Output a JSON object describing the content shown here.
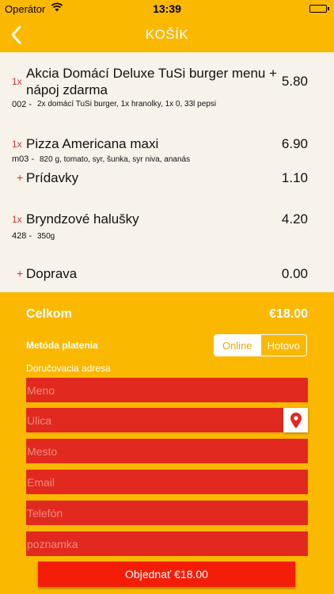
{
  "status_bar": {
    "carrier": "Operátor",
    "time": "13:39"
  },
  "nav": {
    "title": "KOŠÍK",
    "back_icon": "chevron-left-icon"
  },
  "cart": {
    "items": [
      {
        "qty": "1x",
        "name": "Akcia Domácí Deluxe TuSi burger menu + nápoj zdarma",
        "price": "5.80",
        "code": "002 -",
        "desc": "2x domácí TuSi burger, 1x hranolky, 1x 0, 33l pepsi"
      },
      {
        "qty": "1x",
        "name": "Pizza Americana maxi",
        "price": "6.90",
        "code": "m03 -",
        "desc": "820 g, tomato, syr, šunka, syr niva, ananás"
      },
      {
        "plus": "+",
        "name": "Prídavky",
        "price": "1.10"
      },
      {
        "qty": "1x",
        "name": "Bryndzové halušky",
        "price": "4.20",
        "code": "428 -",
        "desc": "350g"
      },
      {
        "plus": "+",
        "name": "Doprava",
        "price": "0.00"
      }
    ]
  },
  "summary": {
    "total_label": "Celkom",
    "total_value": "€18.00"
  },
  "payment": {
    "label": "Metóda platenia",
    "options": [
      "Online",
      "Hotovo"
    ],
    "selected": "Online"
  },
  "address": {
    "label": "Doručovacia adresa",
    "placeholders": {
      "name": "Meno",
      "street": "Ulica",
      "city": "Mesto",
      "email": "Email",
      "phone": "Telefón",
      "note": "poznamka"
    }
  },
  "order_button": "Objednať €18.00",
  "colors": {
    "accent": "#fbb800",
    "field": "#e1291f",
    "button": "#f41d08",
    "qty": "#d0342c"
  }
}
